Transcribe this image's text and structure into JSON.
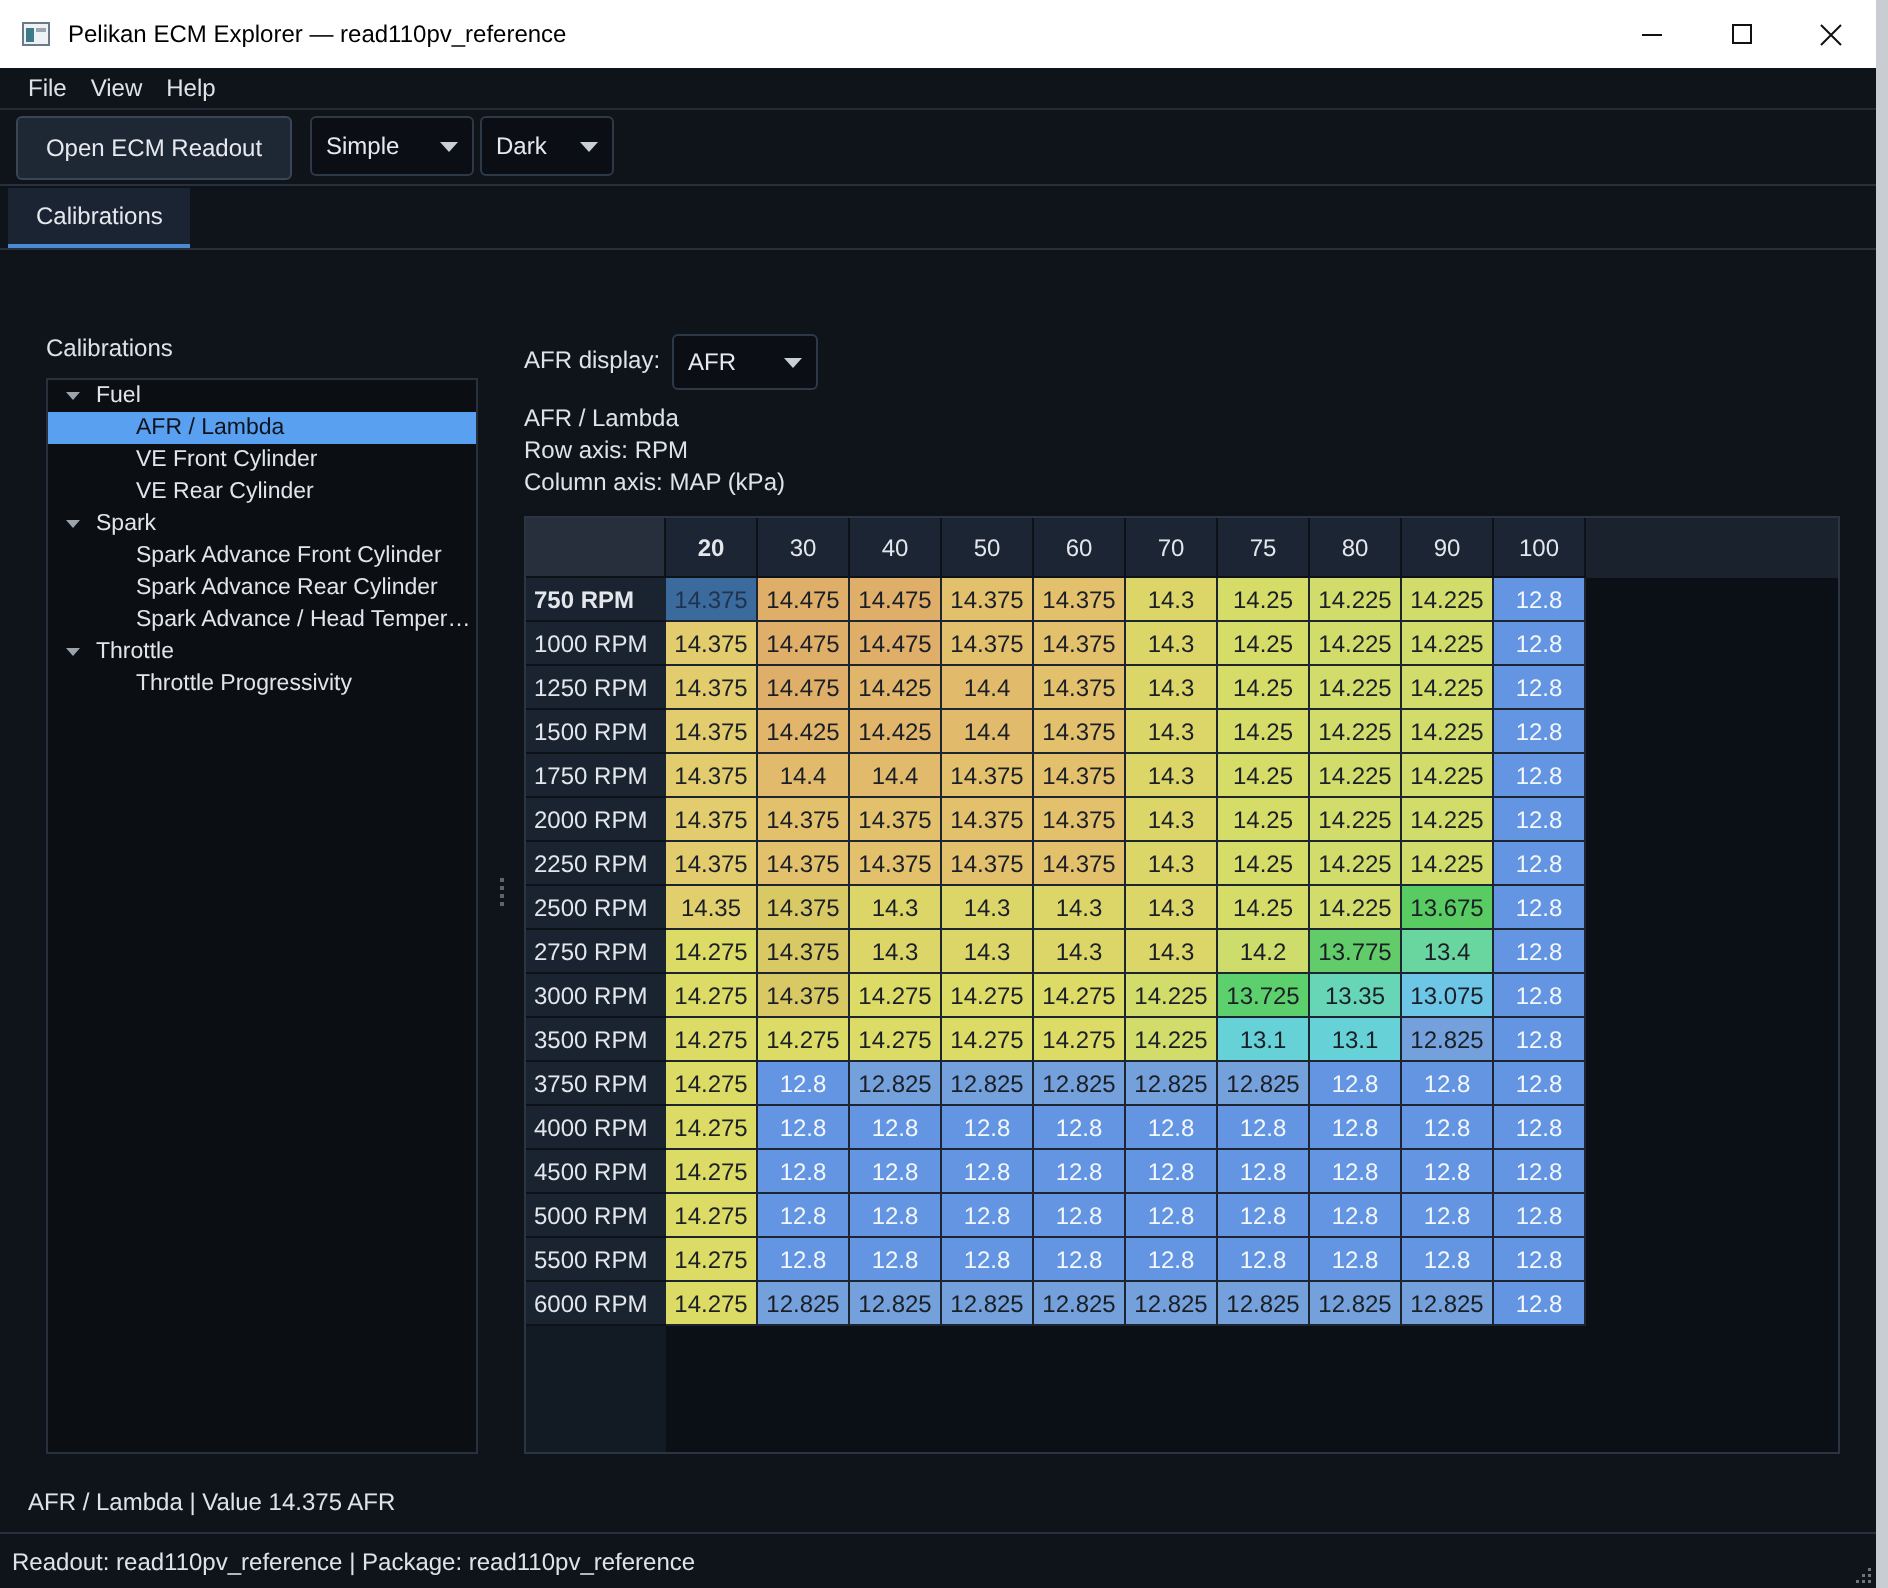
{
  "window": {
    "title": "Pelikan ECM Explorer — read110pv_reference"
  },
  "menu": [
    "File",
    "View",
    "Help"
  ],
  "toolbar": {
    "open_button": "Open ECM Readout",
    "mode_dropdown": {
      "value": "Simple"
    },
    "theme_dropdown": {
      "value": "Dark"
    }
  },
  "tabs": [
    {
      "label": "Calibrations",
      "selected": true
    }
  ],
  "tree": {
    "title": "Calibrations",
    "items": [
      {
        "label": "Fuel",
        "expanded": true,
        "selected": false,
        "children": [
          {
            "label": "AFR / Lambda",
            "selected": true
          },
          {
            "label": "VE Front Cylinder",
            "selected": false
          },
          {
            "label": "VE Rear Cylinder",
            "selected": false
          }
        ]
      },
      {
        "label": "Spark",
        "expanded": true,
        "selected": false,
        "children": [
          {
            "label": "Spark Advance Front Cylinder",
            "selected": false
          },
          {
            "label": "Spark Advance Rear Cylinder",
            "selected": false
          },
          {
            "label": "Spark Advance / Head Temper…",
            "selected": false
          }
        ]
      },
      {
        "label": "Throttle",
        "expanded": true,
        "selected": false,
        "children": [
          {
            "label": "Throttle Progressivity",
            "selected": false
          }
        ]
      }
    ]
  },
  "afr_display": {
    "label": "AFR display:",
    "value": "AFR"
  },
  "table_info": [
    "AFR / Lambda",
    "Row axis: RPM",
    "Column axis: MAP (kPa)"
  ],
  "table": {
    "columns": [
      "20",
      "30",
      "40",
      "50",
      "60",
      "70",
      "75",
      "80",
      "90",
      "100"
    ],
    "rows": [
      {
        "label": "750 RPM",
        "cells": [
          {
            "value": "14.375",
            "selected": true
          },
          {
            "value": "14.475",
            "color": "#dfae68",
            "selected": false
          },
          {
            "value": "14.475",
            "color": "#dfae68",
            "selected": false
          },
          {
            "value": "14.375",
            "color": "#e3c16c",
            "selected": false
          },
          {
            "value": "14.375",
            "color": "#e3c16c",
            "selected": false
          },
          {
            "value": "14.3",
            "color": "#dcd568",
            "selected": false
          },
          {
            "value": "14.25",
            "color": "#d6dc68",
            "selected": false
          },
          {
            "value": "14.225",
            "color": "#d2dc6a",
            "selected": false
          },
          {
            "value": "14.225",
            "color": "#d2dc6a",
            "selected": false
          },
          {
            "value": "12.8",
            "color": "#6395e2",
            "selected": false
          }
        ]
      },
      {
        "label": "1000 RPM",
        "cells": [
          {
            "value": "14.375",
            "color": "#e2cc6e",
            "selected": false
          },
          {
            "value": "14.475",
            "color": "#dfae68",
            "selected": false
          },
          {
            "value": "14.475",
            "color": "#dfae68",
            "selected": false
          },
          {
            "value": "14.375",
            "color": "#e3c16c",
            "selected": false
          },
          {
            "value": "14.375",
            "color": "#e3c16c",
            "selected": false
          },
          {
            "value": "14.3",
            "color": "#dcd568",
            "selected": false
          },
          {
            "value": "14.25",
            "color": "#d6dc68",
            "selected": false
          },
          {
            "value": "14.225",
            "color": "#d2dc6a",
            "selected": false
          },
          {
            "value": "14.225",
            "color": "#d2dc6a",
            "selected": false
          },
          {
            "value": "12.8",
            "color": "#6395e2",
            "selected": false
          }
        ]
      },
      {
        "label": "1250 RPM",
        "cells": [
          {
            "value": "14.375",
            "color": "#e2cc6e",
            "selected": false
          },
          {
            "value": "14.475",
            "color": "#dfae68",
            "selected": false
          },
          {
            "value": "14.425",
            "color": "#e1b66a",
            "selected": false
          },
          {
            "value": "14.4",
            "color": "#e2ba6b",
            "selected": false
          },
          {
            "value": "14.375",
            "color": "#e3c16c",
            "selected": false
          },
          {
            "value": "14.3",
            "color": "#dcd568",
            "selected": false
          },
          {
            "value": "14.25",
            "color": "#d6dc68",
            "selected": false
          },
          {
            "value": "14.225",
            "color": "#d2dc6a",
            "selected": false
          },
          {
            "value": "14.225",
            "color": "#d2dc6a",
            "selected": false
          },
          {
            "value": "12.8",
            "color": "#6395e2",
            "selected": false
          }
        ]
      },
      {
        "label": "1500 RPM",
        "cells": [
          {
            "value": "14.375",
            "color": "#e2cc6e",
            "selected": false
          },
          {
            "value": "14.425",
            "color": "#e1b66a",
            "selected": false
          },
          {
            "value": "14.425",
            "color": "#e1b66a",
            "selected": false
          },
          {
            "value": "14.4",
            "color": "#e2ba6b",
            "selected": false
          },
          {
            "value": "14.375",
            "color": "#e3c16c",
            "selected": false
          },
          {
            "value": "14.3",
            "color": "#dcd568",
            "selected": false
          },
          {
            "value": "14.25",
            "color": "#d6dc68",
            "selected": false
          },
          {
            "value": "14.225",
            "color": "#d2dc6a",
            "selected": false
          },
          {
            "value": "14.225",
            "color": "#d2dc6a",
            "selected": false
          },
          {
            "value": "12.8",
            "color": "#6395e2",
            "selected": false
          }
        ]
      },
      {
        "label": "1750 RPM",
        "cells": [
          {
            "value": "14.375",
            "color": "#e2cc6e",
            "selected": false
          },
          {
            "value": "14.4",
            "color": "#e2ba6b",
            "selected": false
          },
          {
            "value": "14.4",
            "color": "#e2ba6b",
            "selected": false
          },
          {
            "value": "14.375",
            "color": "#e3c16c",
            "selected": false
          },
          {
            "value": "14.375",
            "color": "#e3c16c",
            "selected": false
          },
          {
            "value": "14.3",
            "color": "#dcd568",
            "selected": false
          },
          {
            "value": "14.25",
            "color": "#d6dc68",
            "selected": false
          },
          {
            "value": "14.225",
            "color": "#d2dc6a",
            "selected": false
          },
          {
            "value": "14.225",
            "color": "#d2dc6a",
            "selected": false
          },
          {
            "value": "12.8",
            "color": "#6395e2",
            "selected": false
          }
        ]
      },
      {
        "label": "2000 RPM",
        "cells": [
          {
            "value": "14.375",
            "color": "#e2cc6e",
            "selected": false
          },
          {
            "value": "14.375",
            "color": "#e3c16c",
            "selected": false
          },
          {
            "value": "14.375",
            "color": "#e3c16c",
            "selected": false
          },
          {
            "value": "14.375",
            "color": "#e3c16c",
            "selected": false
          },
          {
            "value": "14.375",
            "color": "#e3c16c",
            "selected": false
          },
          {
            "value": "14.3",
            "color": "#dcd568",
            "selected": false
          },
          {
            "value": "14.25",
            "color": "#d6dc68",
            "selected": false
          },
          {
            "value": "14.225",
            "color": "#d2dc6a",
            "selected": false
          },
          {
            "value": "14.225",
            "color": "#d2dc6a",
            "selected": false
          },
          {
            "value": "12.8",
            "color": "#6395e2",
            "selected": false
          }
        ]
      },
      {
        "label": "2250 RPM",
        "cells": [
          {
            "value": "14.375",
            "color": "#e2cc6e",
            "selected": false
          },
          {
            "value": "14.375",
            "color": "#e3c16c",
            "selected": false
          },
          {
            "value": "14.375",
            "color": "#e3c16c",
            "selected": false
          },
          {
            "value": "14.375",
            "color": "#e3c16c",
            "selected": false
          },
          {
            "value": "14.375",
            "color": "#e3c16c",
            "selected": false
          },
          {
            "value": "14.3",
            "color": "#dcd568",
            "selected": false
          },
          {
            "value": "14.25",
            "color": "#d6dc68",
            "selected": false
          },
          {
            "value": "14.225",
            "color": "#d2dc6a",
            "selected": false
          },
          {
            "value": "14.225",
            "color": "#d2dc6a",
            "selected": false
          },
          {
            "value": "12.8",
            "color": "#6395e2",
            "selected": false
          }
        ]
      },
      {
        "label": "2500 RPM",
        "cells": [
          {
            "value": "14.35",
            "color": "#e0cf6c",
            "selected": false
          },
          {
            "value": "14.375",
            "color": "#d9c964",
            "selected": false
          },
          {
            "value": "14.3",
            "color": "#dcd568",
            "selected": false
          },
          {
            "value": "14.3",
            "color": "#dcd568",
            "selected": false
          },
          {
            "value": "14.3",
            "color": "#dcd568",
            "selected": false
          },
          {
            "value": "14.3",
            "color": "#dcd568",
            "selected": false
          },
          {
            "value": "14.25",
            "color": "#d6dc68",
            "selected": false
          },
          {
            "value": "14.225",
            "color": "#d2dc6a",
            "selected": false
          },
          {
            "value": "13.675",
            "color": "#58cc62",
            "selected": false
          },
          {
            "value": "12.8",
            "color": "#6395e2",
            "selected": false
          }
        ]
      },
      {
        "label": "2750 RPM",
        "cells": [
          {
            "value": "14.275",
            "color": "#dcdb66",
            "selected": false
          },
          {
            "value": "14.375",
            "color": "#d9c964",
            "selected": false
          },
          {
            "value": "14.3",
            "color": "#dcd568",
            "selected": false
          },
          {
            "value": "14.3",
            "color": "#dcd568",
            "selected": false
          },
          {
            "value": "14.3",
            "color": "#dcd568",
            "selected": false
          },
          {
            "value": "14.3",
            "color": "#dcd568",
            "selected": false
          },
          {
            "value": "14.2",
            "color": "#cddc6a",
            "selected": false
          },
          {
            "value": "13.775",
            "color": "#62cc6a",
            "selected": false
          },
          {
            "value": "13.4",
            "color": "#69d6a0",
            "selected": false
          },
          {
            "value": "12.8",
            "color": "#6395e2",
            "selected": false
          }
        ]
      },
      {
        "label": "3000 RPM",
        "cells": [
          {
            "value": "14.275",
            "color": "#dcdb66",
            "selected": false
          },
          {
            "value": "14.375",
            "color": "#d9c964",
            "selected": false
          },
          {
            "value": "14.275",
            "color": "#dcdb66",
            "selected": false
          },
          {
            "value": "14.275",
            "color": "#dcdb66",
            "selected": false
          },
          {
            "value": "14.275",
            "color": "#dcdb66",
            "selected": false
          },
          {
            "value": "14.225",
            "color": "#d2dc6a",
            "selected": false
          },
          {
            "value": "13.725",
            "color": "#5dd06e",
            "selected": false
          },
          {
            "value": "13.35",
            "color": "#67d6b6",
            "selected": false
          },
          {
            "value": "13.075",
            "color": "#6ec6e6",
            "selected": false
          },
          {
            "value": "12.8",
            "color": "#6395e2",
            "selected": false
          }
        ]
      },
      {
        "label": "3500 RPM",
        "cells": [
          {
            "value": "14.275",
            "color": "#dcdb66",
            "selected": false
          },
          {
            "value": "14.275",
            "color": "#dcdb66",
            "selected": false
          },
          {
            "value": "14.275",
            "color": "#dcdb66",
            "selected": false
          },
          {
            "value": "14.275",
            "color": "#dcdb66",
            "selected": false
          },
          {
            "value": "14.275",
            "color": "#dcdb66",
            "selected": false
          },
          {
            "value": "14.225",
            "color": "#d2dc6a",
            "selected": false
          },
          {
            "value": "13.1",
            "color": "#66d2d8",
            "selected": false
          },
          {
            "value": "13.1",
            "color": "#66d2d8",
            "selected": false
          },
          {
            "value": "12.825",
            "color": "#74a0dc",
            "selected": false
          },
          {
            "value": "12.8",
            "color": "#6395e2",
            "selected": false
          }
        ]
      },
      {
        "label": "3750 RPM",
        "cells": [
          {
            "value": "14.275",
            "color": "#dcdb66",
            "selected": false
          },
          {
            "value": "12.8",
            "color": "#6395e2",
            "selected": false
          },
          {
            "value": "12.825",
            "color": "#74a0dc",
            "selected": false
          },
          {
            "value": "12.825",
            "color": "#74a0dc",
            "selected": false
          },
          {
            "value": "12.825",
            "color": "#74a0dc",
            "selected": false
          },
          {
            "value": "12.825",
            "color": "#74a0dc",
            "selected": false
          },
          {
            "value": "12.825",
            "color": "#74a0dc",
            "selected": false
          },
          {
            "value": "12.8",
            "color": "#6395e2",
            "selected": false
          },
          {
            "value": "12.8",
            "color": "#6395e2",
            "selected": false
          },
          {
            "value": "12.8",
            "color": "#6395e2",
            "selected": false
          }
        ]
      },
      {
        "label": "4000 RPM",
        "cells": [
          {
            "value": "14.275",
            "color": "#dcdb66",
            "selected": false
          },
          {
            "value": "12.8",
            "color": "#6395e2",
            "selected": false
          },
          {
            "value": "12.8",
            "color": "#6395e2",
            "selected": false
          },
          {
            "value": "12.8",
            "color": "#6395e2",
            "selected": false
          },
          {
            "value": "12.8",
            "color": "#6395e2",
            "selected": false
          },
          {
            "value": "12.8",
            "color": "#6395e2",
            "selected": false
          },
          {
            "value": "12.8",
            "color": "#6395e2",
            "selected": false
          },
          {
            "value": "12.8",
            "color": "#6395e2",
            "selected": false
          },
          {
            "value": "12.8",
            "color": "#6395e2",
            "selected": false
          },
          {
            "value": "12.8",
            "color": "#6395e2",
            "selected": false
          }
        ]
      },
      {
        "label": "4500 RPM",
        "cells": [
          {
            "value": "14.275",
            "color": "#dcdb66",
            "selected": false
          },
          {
            "value": "12.8",
            "color": "#6395e2",
            "selected": false
          },
          {
            "value": "12.8",
            "color": "#6395e2",
            "selected": false
          },
          {
            "value": "12.8",
            "color": "#6395e2",
            "selected": false
          },
          {
            "value": "12.8",
            "color": "#6395e2",
            "selected": false
          },
          {
            "value": "12.8",
            "color": "#6395e2",
            "selected": false
          },
          {
            "value": "12.8",
            "color": "#6395e2",
            "selected": false
          },
          {
            "value": "12.8",
            "color": "#6395e2",
            "selected": false
          },
          {
            "value": "12.8",
            "color": "#6395e2",
            "selected": false
          },
          {
            "value": "12.8",
            "color": "#6395e2",
            "selected": false
          }
        ]
      },
      {
        "label": "5000 RPM",
        "cells": [
          {
            "value": "14.275",
            "color": "#dcdb66",
            "selected": false
          },
          {
            "value": "12.8",
            "color": "#6395e2",
            "selected": false
          },
          {
            "value": "12.8",
            "color": "#6395e2",
            "selected": false
          },
          {
            "value": "12.8",
            "color": "#6395e2",
            "selected": false
          },
          {
            "value": "12.8",
            "color": "#6395e2",
            "selected": false
          },
          {
            "value": "12.8",
            "color": "#6395e2",
            "selected": false
          },
          {
            "value": "12.8",
            "color": "#6395e2",
            "selected": false
          },
          {
            "value": "12.8",
            "color": "#6395e2",
            "selected": false
          },
          {
            "value": "12.8",
            "color": "#6395e2",
            "selected": false
          },
          {
            "value": "12.8",
            "color": "#6395e2",
            "selected": false
          }
        ]
      },
      {
        "label": "5500 RPM",
        "cells": [
          {
            "value": "14.275",
            "color": "#dcdb66",
            "selected": false
          },
          {
            "value": "12.8",
            "color": "#6395e2",
            "selected": false
          },
          {
            "value": "12.8",
            "color": "#6395e2",
            "selected": false
          },
          {
            "value": "12.8",
            "color": "#6395e2",
            "selected": false
          },
          {
            "value": "12.8",
            "color": "#6395e2",
            "selected": false
          },
          {
            "value": "12.8",
            "color": "#6395e2",
            "selected": false
          },
          {
            "value": "12.8",
            "color": "#6395e2",
            "selected": false
          },
          {
            "value": "12.8",
            "color": "#6395e2",
            "selected": false
          },
          {
            "value": "12.8",
            "color": "#6395e2",
            "selected": false
          },
          {
            "value": "12.8",
            "color": "#6395e2",
            "selected": false
          }
        ]
      },
      {
        "label": "6000 RPM",
        "cells": [
          {
            "value": "14.275",
            "color": "#dcdb66",
            "selected": false
          },
          {
            "value": "12.825",
            "color": "#74a0dc",
            "selected": false
          },
          {
            "value": "12.825",
            "color": "#74a0dc",
            "selected": false
          },
          {
            "value": "12.825",
            "color": "#74a0dc",
            "selected": false
          },
          {
            "value": "12.825",
            "color": "#74a0dc",
            "selected": false
          },
          {
            "value": "12.825",
            "color": "#74a0dc",
            "selected": false
          },
          {
            "value": "12.825",
            "color": "#74a0dc",
            "selected": false
          },
          {
            "value": "12.825",
            "color": "#74a0dc",
            "selected": false
          },
          {
            "value": "12.825",
            "color": "#74a0dc",
            "selected": false
          },
          {
            "value": "12.8",
            "color": "#6395e2",
            "selected": false
          }
        ]
      }
    ]
  },
  "value_line": "AFR / Lambda | Value 14.375 AFR",
  "status_bar": "Readout: read110pv_reference | Package: read110pv_reference"
}
